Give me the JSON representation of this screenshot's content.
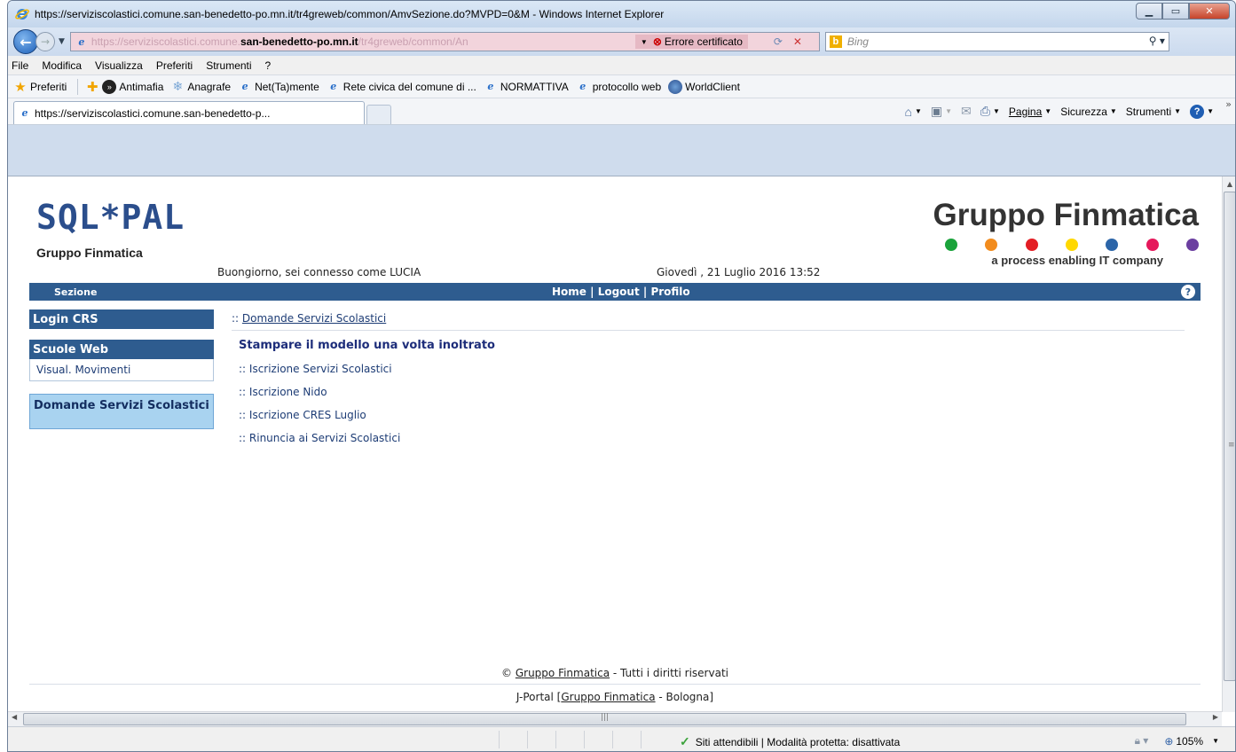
{
  "window": {
    "title": "https://serviziscolastici.comune.san-benedetto-po.mn.it/tr4greweb/common/AmvSezione.do?MVPD=0&M - Windows Internet Explorer"
  },
  "address": {
    "url_prefix": "https://serviziscolastici.comune.",
    "url_host": "san-benedetto-po.mn.it",
    "url_tail": "/tr4greweb/common/An",
    "cert_error": "Errore certificato",
    "search_placeholder": "Bing"
  },
  "menu": [
    "File",
    "Modifica",
    "Visualizza",
    "Preferiti",
    "Strumenti",
    "?"
  ],
  "favorites": {
    "label": "Preferiti",
    "items": [
      "Antimafia",
      "Anagrafe",
      "Net(Ta)mente",
      "Rete civica del comune di ...",
      "NORMATTIVA",
      "protocollo web",
      "WorldClient"
    ]
  },
  "tab": {
    "title": "https://serviziscolastici.comune.san-benedetto-p..."
  },
  "commands": {
    "page": "Pagina",
    "security": "Sicurezza",
    "tools": "Strumenti"
  },
  "page": {
    "logo_main": "SQL*PAL",
    "logo_sub": "Gruppo Finmatica",
    "greeting": "Buongiorno, sei connesso come LUCIA",
    "datetime": "Giovedì , 21 Luglio 2016 13:52",
    "brand_title": "Gruppo Finmatica",
    "brand_tagline": "a process enabling IT company",
    "brand_dot_colors": [
      "#1aa33b",
      "#f28c1e",
      "#e31e24",
      "#ffd800",
      "#2c65a8",
      "#e5185b",
      "#6b3fa0"
    ],
    "nav": {
      "section": "Sezione",
      "home": "Home",
      "logout": "Logout",
      "profile": "Profilo",
      "sep": " | "
    },
    "sidebar": {
      "login": "Login CRS",
      "scuole": "Scuole Web",
      "movimenti": "Visual. Movimenti",
      "domande": "Domande Servizi Scolastici"
    },
    "breadcrumb": "Domande Servizi Scolastici",
    "breadcrumb_prefix": ":: ",
    "heading": "Stampare il modello una volta inoltrato",
    "services": [
      ":: Iscrizione Servizi Scolastici",
      ":: Iscrizione Nido",
      ":: Iscrizione CRES Luglio",
      ":: Rinuncia ai Servizi Scolastici"
    ],
    "footer": {
      "copyright_symbol": "©",
      "company": "Gruppo Finmatica",
      "rights": "- Tutti i diritti riservati",
      "portal_prefix": "J-Portal [",
      "portal_company": "Gruppo Finmatica",
      "portal_suffix": "- Bologna]"
    }
  },
  "statusbar": {
    "zone": "Siti attendibili | Modalità protetta: disattivata",
    "zoom": "105%"
  }
}
